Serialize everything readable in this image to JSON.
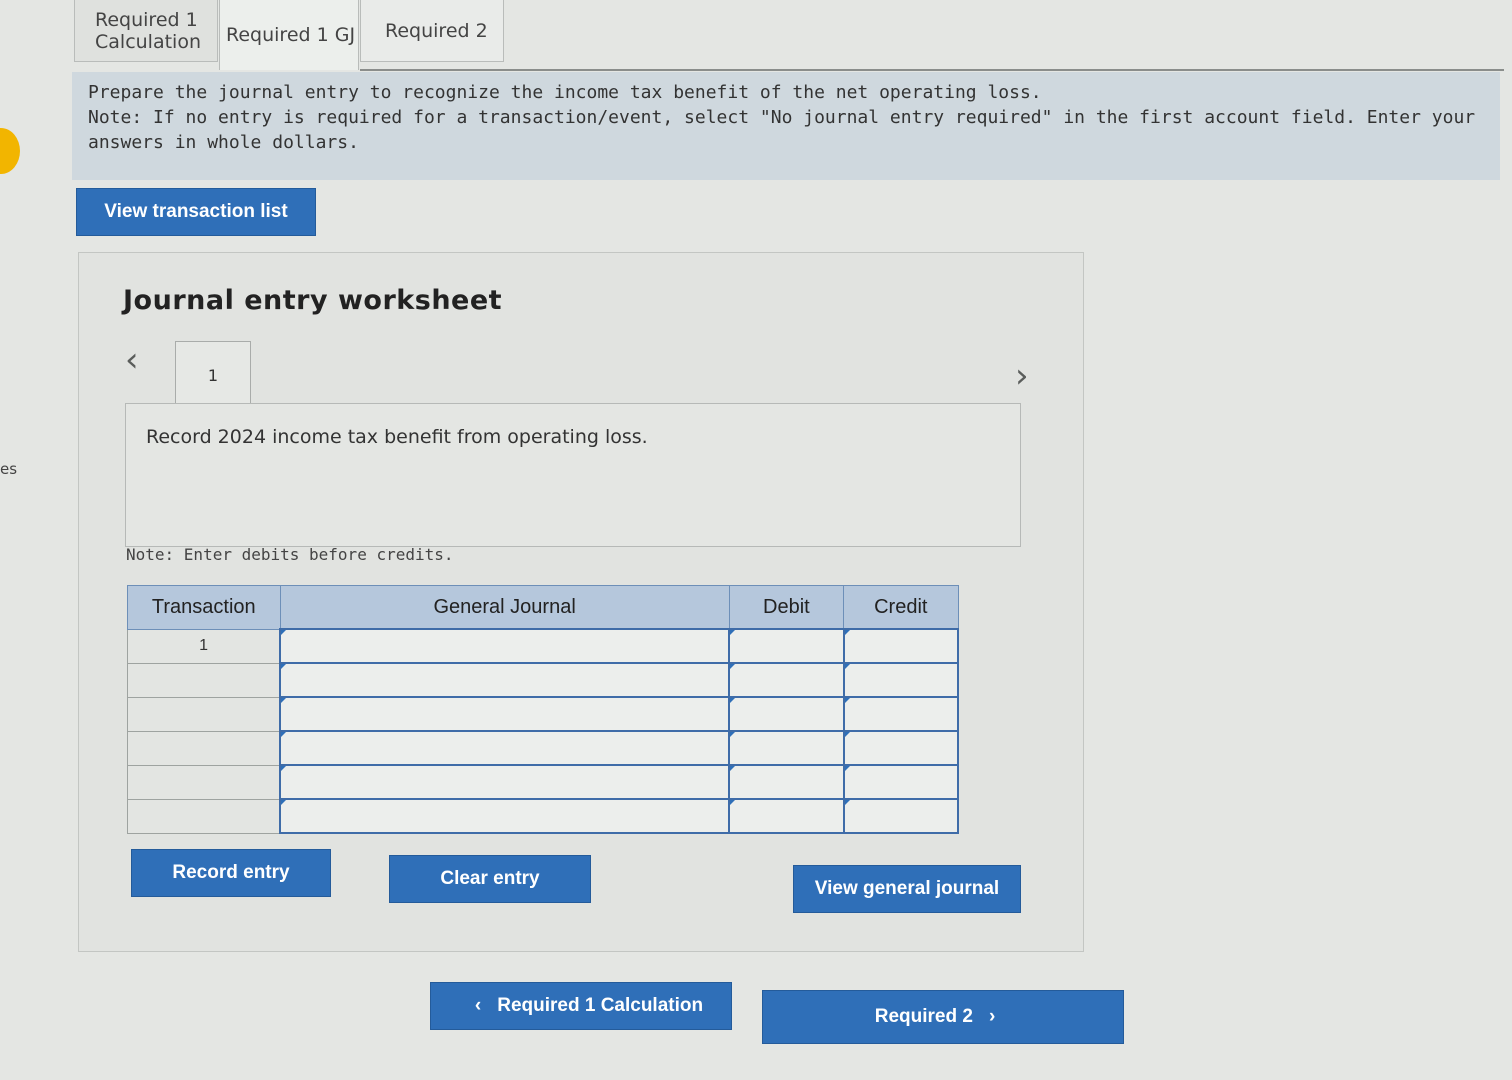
{
  "side": {
    "cut_text": "es"
  },
  "tabs": [
    {
      "label": "Required 1 Calculation"
    },
    {
      "label": "Required 1 GJ"
    },
    {
      "label": "Required 2"
    }
  ],
  "instructions": {
    "line1": "Prepare the journal entry to recognize the income tax benefit of the net operating loss.",
    "line2": "Note: If no entry is required for a transaction/event, select \"No journal entry required\" in the first account field. Enter your answers in whole dollars."
  },
  "buttons": {
    "view_transaction_list": "View transaction list",
    "record_entry": "Record entry",
    "clear_entry": "Clear entry",
    "view_general_journal": "View general journal",
    "prev": "Required 1 Calculation",
    "next": "Required 2"
  },
  "worksheet": {
    "title": "Journal entry worksheet",
    "page": "1",
    "description": "Record 2024 income tax benefit from operating loss.",
    "note": "Note: Enter debits before credits.",
    "columns": [
      "Transaction",
      "General Journal",
      "Debit",
      "Credit"
    ],
    "rows": [
      {
        "transaction": "1",
        "account": "",
        "debit": "",
        "credit": ""
      },
      {
        "transaction": "",
        "account": "",
        "debit": "",
        "credit": ""
      },
      {
        "transaction": "",
        "account": "",
        "debit": "",
        "credit": ""
      },
      {
        "transaction": "",
        "account": "",
        "debit": "",
        "credit": ""
      },
      {
        "transaction": "",
        "account": "",
        "debit": "",
        "credit": ""
      },
      {
        "transaction": "",
        "account": "",
        "debit": "",
        "credit": ""
      }
    ]
  }
}
